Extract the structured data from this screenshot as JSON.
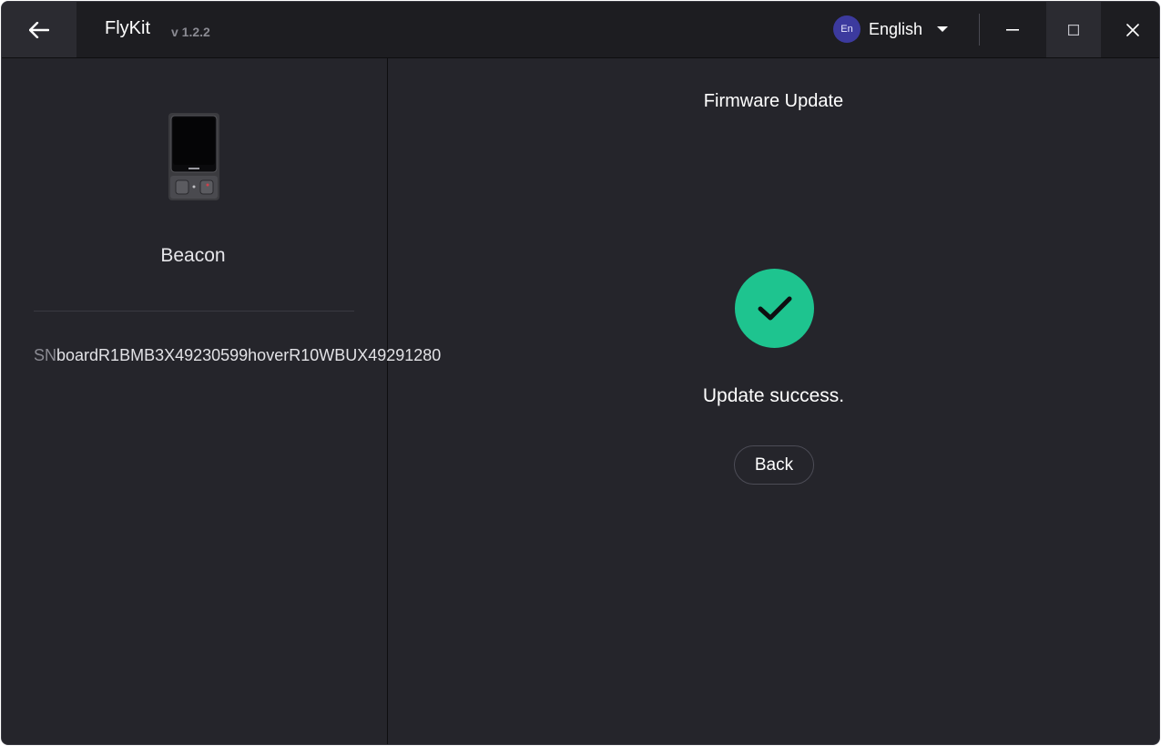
{
  "titlebar": {
    "app_name": "FlyKit",
    "version": "v 1.2.2",
    "back_icon": "arrow-left-icon",
    "language": {
      "badge": "En",
      "selected": "English",
      "dropdown_icon": "caret-down-icon"
    },
    "window_controls": {
      "minimize_icon": "minimize-icon",
      "maximize_icon": "maximize-icon",
      "close_icon": "close-icon"
    }
  },
  "device": {
    "image_icon": "device-image",
    "name": "Beacon",
    "serial_prefix": "SN",
    "serial_value": "boardR1BMB3X49230599hoverR10WBUX49291280"
  },
  "main": {
    "title": "Firmware Update",
    "status_icon": "checkmark-icon",
    "status_text": "Update success.",
    "back_button_label": "Back"
  },
  "colors": {
    "background": "#25252b",
    "titlebar": "#1d1d21",
    "success": "#1ec48f",
    "language_badge": "#3c3a9e"
  }
}
